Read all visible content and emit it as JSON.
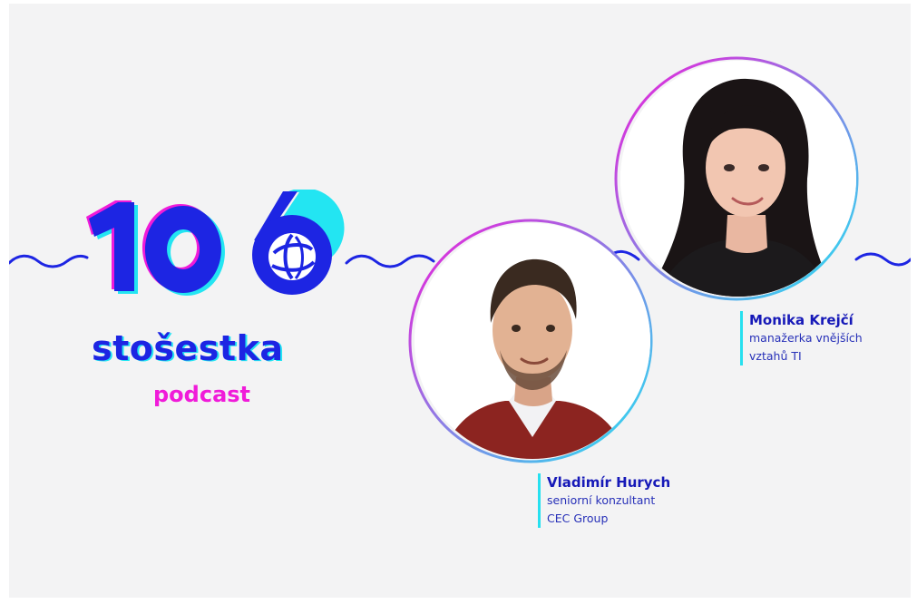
{
  "brand": {
    "number": "106",
    "name": "stošestka",
    "subtitle": "podcast",
    "colors": {
      "primary": "#1d25e3",
      "accent_cyan": "#23e5f2",
      "accent_magenta": "#f01bd9",
      "background": "#f3f3f4"
    },
    "logo_icon": "transparency-international-globe-icon"
  },
  "guests": [
    {
      "name": "Monika Krejčí",
      "role_line1": "manažerka vnějších",
      "role_line2": "vztahů TI",
      "photo": "woman-portrait-photo"
    },
    {
      "name": "Vladimír Hurych",
      "role_line1": "seniorní konzultant",
      "role_line2": "CEC Group",
      "photo": "man-portrait-photo"
    }
  ]
}
